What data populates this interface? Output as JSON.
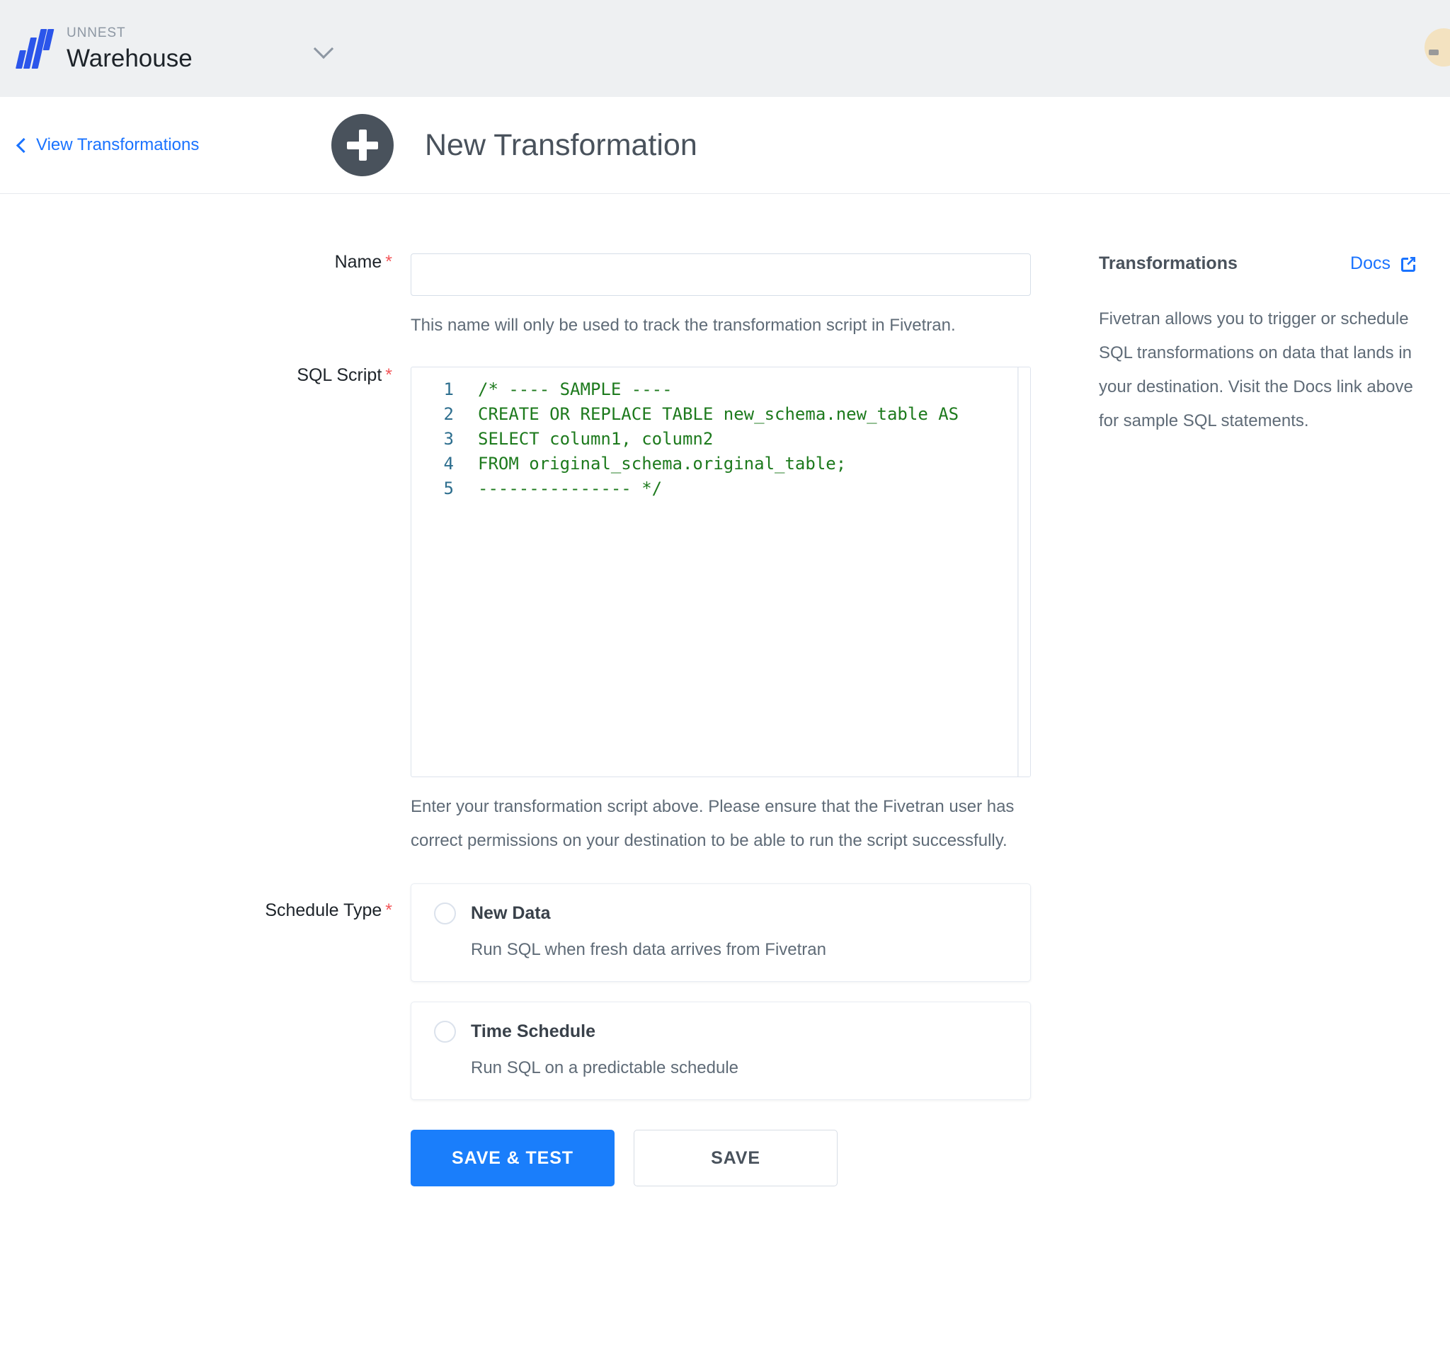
{
  "topbar": {
    "org_label": "UNNEST",
    "destination_name": "Warehouse",
    "chevron_icon": "chevron-down-icon",
    "logo_icon": "fivetran-logo-icon",
    "avatar_icon": "user-avatar"
  },
  "pagehead": {
    "back_link": "View Transformations",
    "back_icon": "chevron-left-icon",
    "plus_icon": "plus-icon",
    "title": "New Transformation"
  },
  "form": {
    "name": {
      "label": "Name",
      "required_marker": "*",
      "value": "",
      "placeholder": "",
      "helper": "This name will only be used to track the transformation script in Fivetran."
    },
    "sql_script": {
      "label": "SQL Script",
      "required_marker": "*",
      "line_numbers": [
        "1",
        "2",
        "3",
        "4",
        "5"
      ],
      "code_lines": [
        "/* ---- SAMPLE ----",
        "CREATE OR REPLACE TABLE new_schema.new_table AS",
        "SELECT column1, column2",
        "FROM original_schema.original_table;",
        "--------------- */"
      ],
      "helper": "Enter your transformation script above. Please ensure that the Fivetran user has correct permissions on your destination to be able to run the script successfully."
    },
    "schedule_type": {
      "label": "Schedule Type",
      "required_marker": "*",
      "options": [
        {
          "title": "New Data",
          "description": "Run SQL when fresh data arrives from Fivetran",
          "selected": false
        },
        {
          "title": "Time Schedule",
          "description": "Run SQL on a predictable schedule",
          "selected": false
        }
      ]
    },
    "buttons": {
      "save_and_test": "SAVE & TEST",
      "save": "SAVE"
    }
  },
  "side_panel": {
    "title": "Transformations",
    "docs_label": "Docs",
    "docs_icon": "external-link-icon",
    "body": "Fivetran allows you to trigger or schedule SQL transformations on data that lands in your destination. Visit the Docs link above for sample SQL statements."
  },
  "colors": {
    "accent_blue": "#1a73ff",
    "primary_button": "#1a7efb",
    "logo_blue": "#2b55ea",
    "required_red": "#f3575a",
    "code_green": "#1d7a1d",
    "gutter_blue": "#2d6e8e",
    "dark_slate": "#49525c"
  }
}
